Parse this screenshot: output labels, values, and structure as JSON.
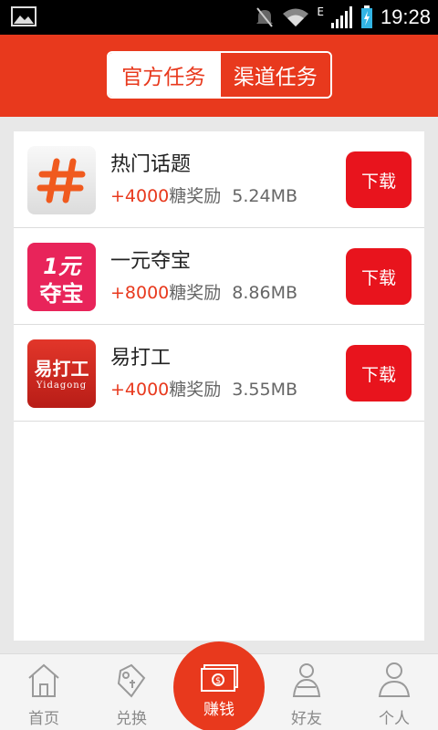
{
  "status_bar": {
    "time": "19:28",
    "network": "E"
  },
  "header": {
    "tabs": [
      {
        "label": "官方任务",
        "active": true
      },
      {
        "label": "渠道任务",
        "active": false
      }
    ],
    "color": "#e8391d"
  },
  "apps": [
    {
      "name": "热门话题",
      "reward": "+4000",
      "reward_unit": "糖奖励",
      "size": "5.24MB",
      "button": "下载",
      "icon": "hashtag-icon"
    },
    {
      "name": "一元夺宝",
      "reward": "+8000",
      "reward_unit": "糖奖励",
      "size": "8.86MB",
      "button": "下载",
      "icon": "yiyuan-logo",
      "icon_text_1": "1元",
      "icon_text_2": "夺宝"
    },
    {
      "name": "易打工",
      "reward": "+4000",
      "reward_unit": "糖奖励",
      "size": "3.55MB",
      "button": "下载",
      "icon": "yidagong-logo",
      "icon_text_1": "易打工",
      "icon_text_2": "Yidagong"
    }
  ],
  "bottom_nav": {
    "items": [
      {
        "label": "首页",
        "icon": "home-icon"
      },
      {
        "label": "兑换",
        "icon": "tag-icon"
      },
      {
        "label": "赚钱",
        "icon": "money-icon",
        "active": true
      },
      {
        "label": "好友",
        "icon": "friends-icon"
      },
      {
        "label": "个人",
        "icon": "person-icon"
      }
    ]
  }
}
